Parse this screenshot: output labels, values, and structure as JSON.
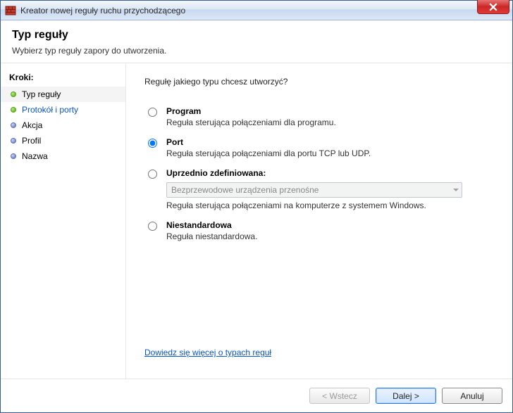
{
  "window": {
    "title": "Kreator nowej reguły ruchu przychodzącego"
  },
  "header": {
    "title": "Typ reguły",
    "subtitle": "Wybierz typ reguły zapory do utworzenia."
  },
  "sidebar": {
    "heading": "Kroki:",
    "steps": [
      {
        "label": "Typ reguły",
        "active": true,
        "link": false
      },
      {
        "label": "Protokół i porty",
        "active": false,
        "link": true
      },
      {
        "label": "Akcja",
        "active": false,
        "link": false
      },
      {
        "label": "Profil",
        "active": false,
        "link": false
      },
      {
        "label": "Nazwa",
        "active": false,
        "link": false
      }
    ]
  },
  "content": {
    "prompt": "Regułę jakiego typu chcesz utworzyć?",
    "options": {
      "program": {
        "title": "Program",
        "desc": "Reguła sterująca połączeniami dla programu."
      },
      "port": {
        "title": "Port",
        "desc": "Reguła sterująca połączeniami dla portu TCP lub UDP."
      },
      "predefined": {
        "title": "Uprzednio zdefiniowana:",
        "combo_value": "Bezprzewodowe urządzenia przenośne",
        "desc": "Reguła sterująca połączeniami na komputerze z systemem Windows."
      },
      "custom": {
        "title": "Niestandardowa",
        "desc": "Reguła niestandardowa."
      }
    },
    "selected": "port",
    "learn_more": "Dowiedz się więcej o typach reguł"
  },
  "footer": {
    "back": "< Wstecz",
    "next": "Dalej >",
    "cancel": "Anuluj"
  }
}
